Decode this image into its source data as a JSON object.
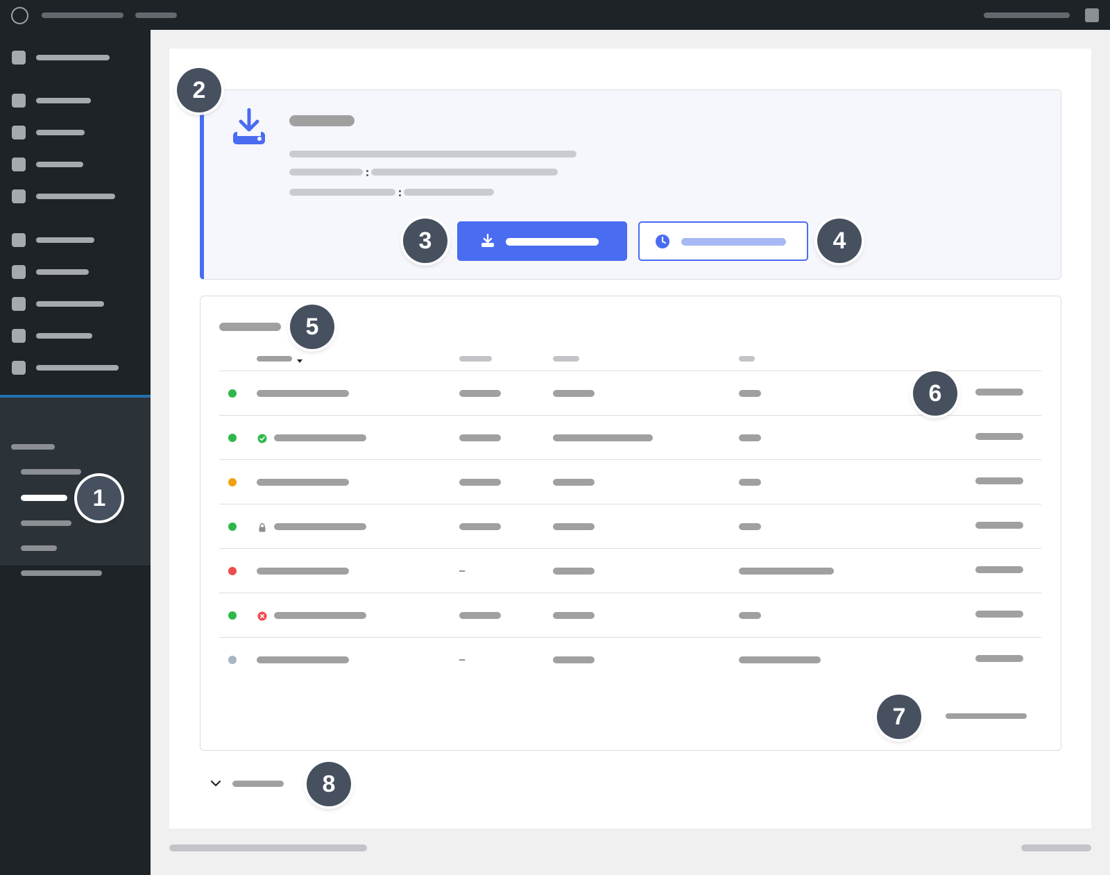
{
  "callouts": [
    "1",
    "2",
    "3",
    "4",
    "5",
    "6",
    "7",
    "8"
  ],
  "colors": {
    "admin_bar": "#1d2327",
    "sidebar": "#1d2327",
    "submenu": "#2c3338",
    "active_menu": "#2271b1",
    "accent": "#4a6cf0",
    "status_green": "#2eb84b",
    "status_orange": "#f0a012",
    "status_red": "#ee4c4c",
    "status_gray": "#a8b4c2"
  },
  "table": {
    "rows": [
      {
        "status": "green",
        "icon": "none",
        "col2": "bar",
        "col3_wide": false,
        "col4_wide": false
      },
      {
        "status": "green",
        "icon": "check-circle-icon",
        "col2": "bar",
        "col3_wide": true,
        "col4_wide": false
      },
      {
        "status": "orange",
        "icon": "none",
        "col2": "bar",
        "col3_wide": false,
        "col4_wide": false
      },
      {
        "status": "green",
        "icon": "lock-icon",
        "col2": "bar",
        "col3_wide": false,
        "col4_wide": false
      },
      {
        "status": "red",
        "icon": "none",
        "col2": "–",
        "col3_wide": false,
        "col4_wide": true
      },
      {
        "status": "green",
        "icon": "error-circle-icon",
        "col2": "bar",
        "col3_wide": false,
        "col4_wide": false
      },
      {
        "status": "gray",
        "icon": "none",
        "col2": "–",
        "col3_wide": false,
        "col4_wide": true
      }
    ]
  },
  "icons": {
    "notice": "download-icon",
    "primary_button": "download-icon",
    "secondary_button": "clock-icon",
    "toggle": "chevron-down-icon"
  }
}
